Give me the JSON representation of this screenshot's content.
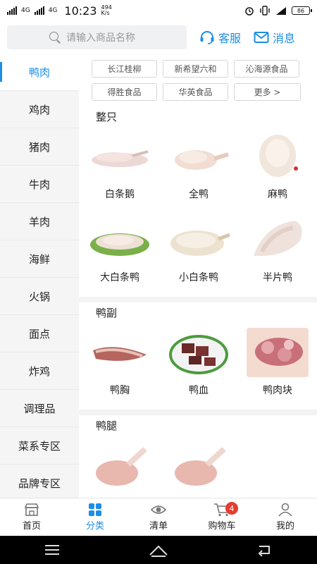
{
  "status_bar": {
    "network_1": "4G",
    "network_2": "4G",
    "time": "10:23",
    "speed": "494 K/s",
    "battery": "86"
  },
  "search": {
    "placeholder": "请输入商品名称"
  },
  "header": {
    "service_label": "客服",
    "message_label": "消息"
  },
  "colors": {
    "accent": "#1d8ee6",
    "badge": "#e63b2e"
  },
  "sidebar": {
    "items": [
      {
        "label": "鸭肉"
      },
      {
        "label": "鸡肉"
      },
      {
        "label": "猪肉"
      },
      {
        "label": "牛肉"
      },
      {
        "label": "羊肉"
      },
      {
        "label": "海鲜"
      },
      {
        "label": "火锅"
      },
      {
        "label": "面点"
      },
      {
        "label": "炸鸡"
      },
      {
        "label": "调理品"
      },
      {
        "label": "菜系专区"
      },
      {
        "label": "品牌专区"
      }
    ],
    "active_index": 0
  },
  "brands": [
    {
      "label": "长江桂柳"
    },
    {
      "label": "新希望六和"
    },
    {
      "label": "沁海源食品"
    },
    {
      "label": "得胜食品"
    },
    {
      "label": "华英食品"
    },
    {
      "label": "更多 >"
    }
  ],
  "sections": [
    {
      "title": "整只",
      "products": [
        {
          "name": "白条鹅",
          "icon": "raw-goose-image"
        },
        {
          "name": "全鸭",
          "icon": "whole-duck-image"
        },
        {
          "name": "麻鸭",
          "icon": "mallard-duck-image"
        },
        {
          "name": "大白条鸭",
          "icon": "large-duck-image"
        },
        {
          "name": "小白条鸭",
          "icon": "small-duck-image"
        },
        {
          "name": "半片鸭",
          "icon": "half-duck-image"
        }
      ]
    },
    {
      "title": "鸭副",
      "products": [
        {
          "name": "鸭胸",
          "icon": "duck-breast-image"
        },
        {
          "name": "鸭血",
          "icon": "duck-blood-image"
        },
        {
          "name": "鸭肉块",
          "icon": "duck-chunks-image"
        }
      ]
    },
    {
      "title": "鸭腿",
      "products": [
        {
          "name": "",
          "icon": "duck-leg-image"
        },
        {
          "name": "",
          "icon": "duck-leg-image"
        }
      ]
    }
  ],
  "tabbar": {
    "tabs": [
      {
        "label": "首页",
        "icon": "store-icon"
      },
      {
        "label": "分类",
        "icon": "grid-icon"
      },
      {
        "label": "清单",
        "icon": "eye-icon"
      },
      {
        "label": "购物车",
        "icon": "cart-icon"
      },
      {
        "label": "我的",
        "icon": "user-icon"
      }
    ],
    "active_index": 1,
    "cart_badge": "4"
  }
}
